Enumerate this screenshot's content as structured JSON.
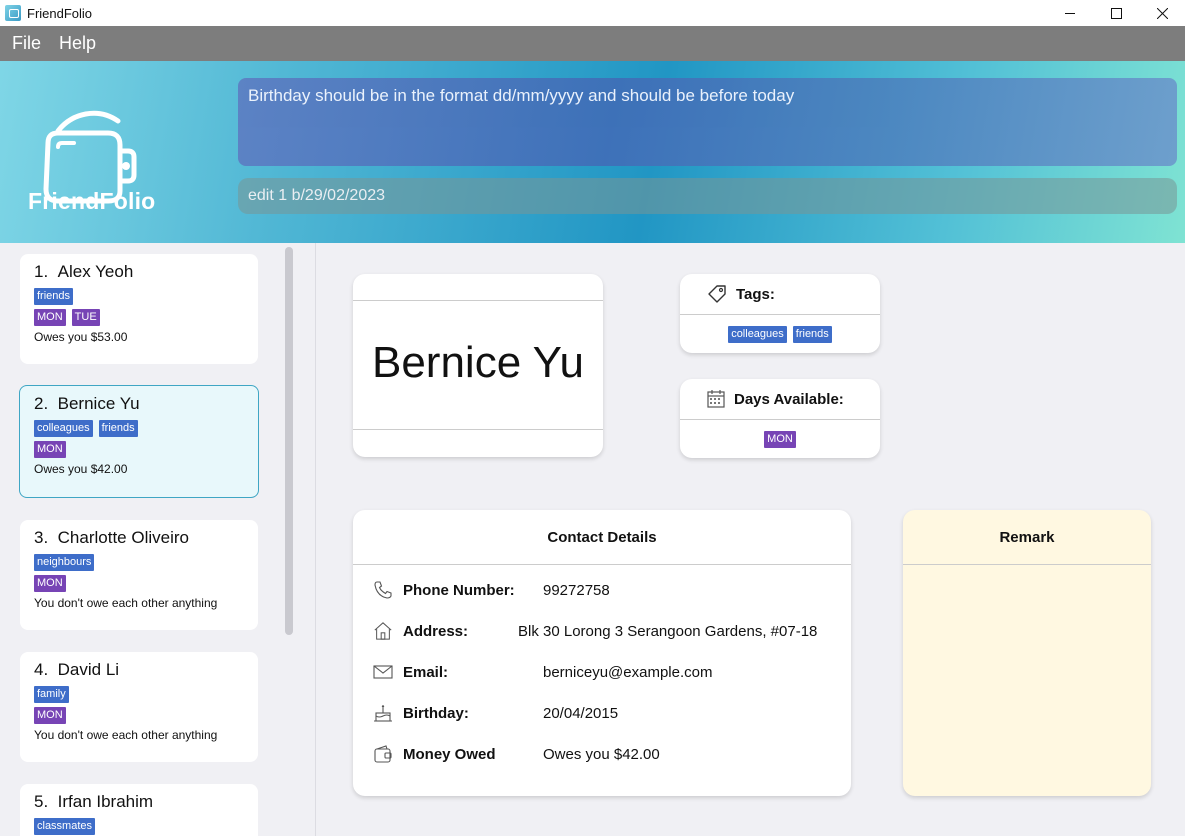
{
  "window": {
    "title": "FriendFolio"
  },
  "menu": {
    "file": "File",
    "help": "Help"
  },
  "header": {
    "logo_text": "FriendFolio",
    "result": "Birthday should be in the format dd/mm/yyyy and should be before today",
    "command": "edit 1 b/29/02/2023"
  },
  "persons": [
    {
      "index": "1.",
      "name": "Alex Yeoh",
      "tags": [
        "friends"
      ],
      "days": [
        "MON",
        "TUE"
      ],
      "owe": "Owes you $53.00"
    },
    {
      "index": "2.",
      "name": "Bernice Yu",
      "tags": [
        "colleagues",
        "friends"
      ],
      "days": [
        "MON"
      ],
      "owe": "Owes you $42.00"
    },
    {
      "index": "3.",
      "name": "Charlotte Oliveiro",
      "tags": [
        "neighbours"
      ],
      "days": [
        "MON"
      ],
      "owe": "You don't owe each other anything"
    },
    {
      "index": "4.",
      "name": "David Li",
      "tags": [
        "family"
      ],
      "days": [
        "MON"
      ],
      "owe": "You don't owe each other anything"
    },
    {
      "index": "5.",
      "name": "Irfan Ibrahim",
      "tags": [
        "classmates"
      ]
    }
  ],
  "detail": {
    "name": "Bernice Yu",
    "tags_label": "Tags:",
    "tags": [
      "colleagues",
      "friends"
    ],
    "days_label": "Days Available:",
    "days": [
      "MON"
    ],
    "contact_title": "Contact Details",
    "phone_label": "Phone Number:",
    "phone": "99272758",
    "address_label": "Address:",
    "address": "Blk 30 Lorong 3 Serangoon Gardens, #07-18",
    "email_label": "Email:",
    "email": "berniceyu@example.com",
    "birthday_label": "Birthday:",
    "birthday": "20/04/2015",
    "money_label": "Money Owed",
    "money": "Owes you $42.00",
    "remark_title": "Remark"
  },
  "colors": {
    "tag": "#3e6dc9",
    "day": "#7744b5",
    "selected_border": "#3fa6c4",
    "remark_bg": "#fff8e1"
  }
}
